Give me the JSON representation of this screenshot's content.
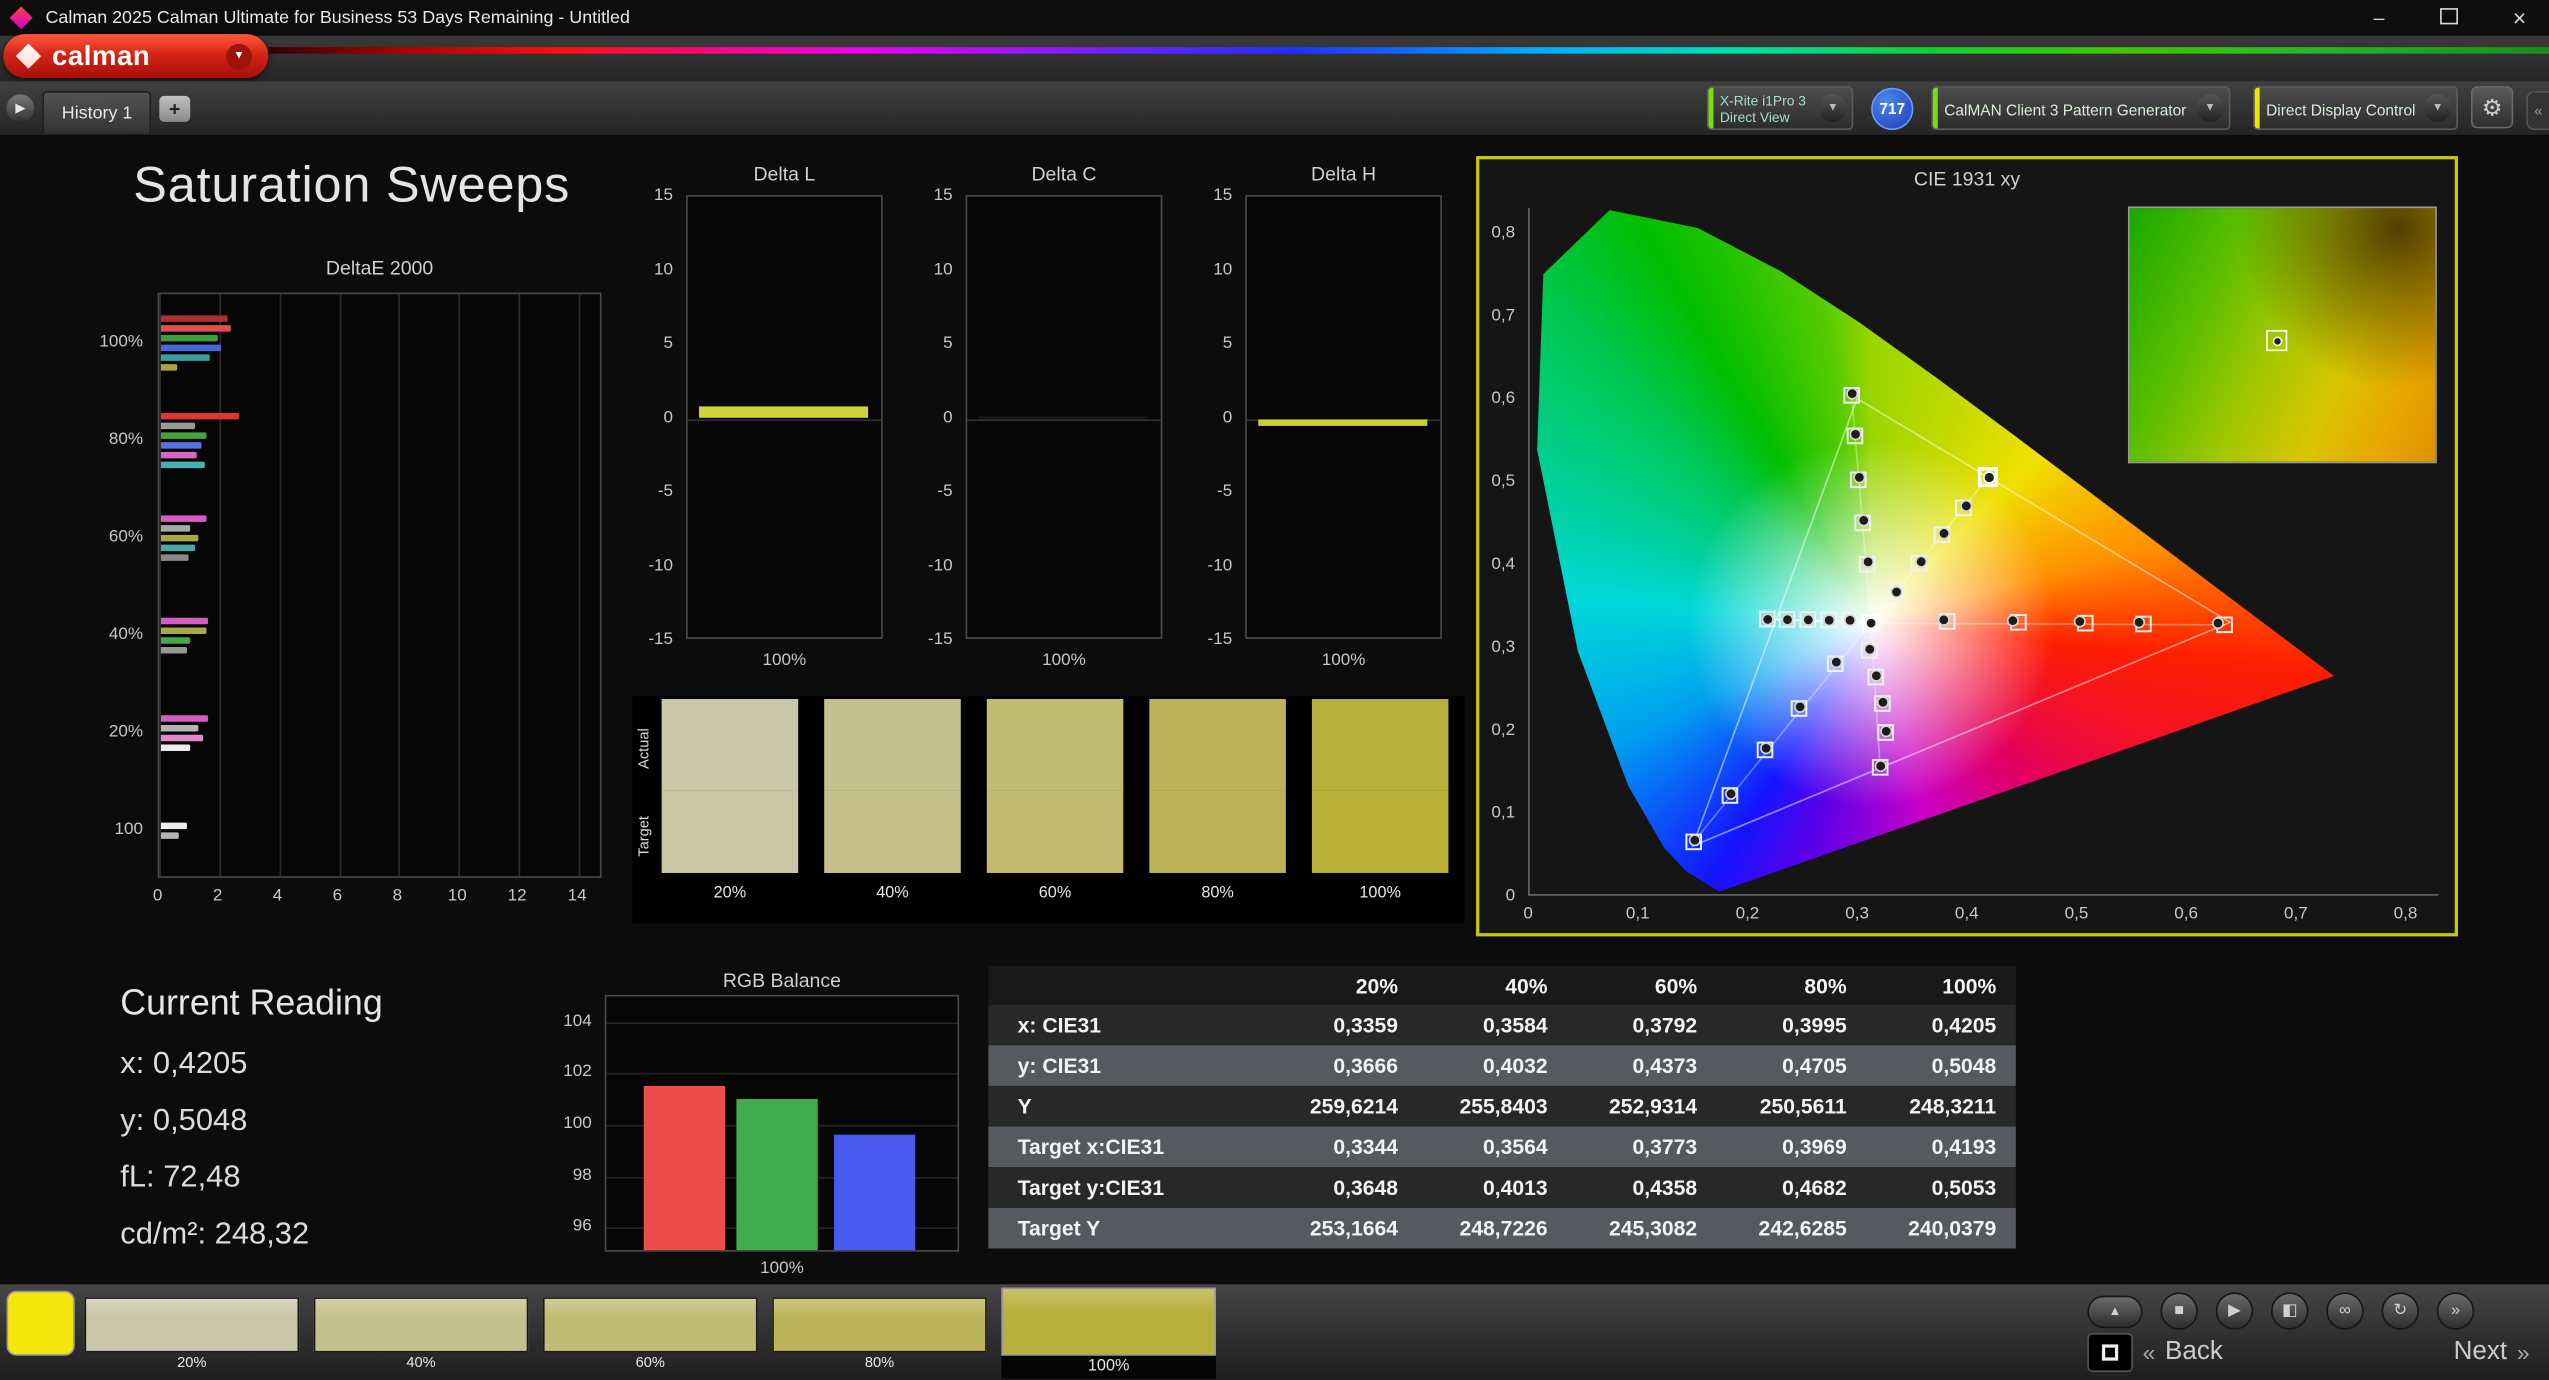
{
  "titlebar": {
    "title": "Calman 2025 Calman Ultimate for Business 53 Days Remaining   - Untitled",
    "minimize": "–",
    "close": "×"
  },
  "header": {
    "logo_text": "calman",
    "meter": {
      "line1": "X-Rite i1Pro 3",
      "line2": "Direct View",
      "accent": "#7ddf00"
    },
    "badge": "717",
    "source_label": "CalMAN Client 3 Pattern Generator",
    "source_accent": "#7ddf00",
    "display_label": "Direct Display Control",
    "display_accent": "#e8e800",
    "gear_glyph": "⚙",
    "chevron_glyph": "▼",
    "handle_glyph": "«"
  },
  "tabbar": {
    "tab_label": "History 1",
    "add_label": "+",
    "arrow_glyph": "▶"
  },
  "page_title": "Saturation Sweeps",
  "current_reading": {
    "title": "Current Reading",
    "lines": [
      "x: 0,4205",
      "y: 0,5048",
      "fL: 72,48",
      "cd/m²: 248,32"
    ]
  },
  "swatch_strip": {
    "row_labels": [
      "Actual",
      "Target"
    ],
    "labels": [
      "20%",
      "40%",
      "60%",
      "80%",
      "100%"
    ],
    "actual": [
      "#c8c7a8",
      "#c5c18e",
      "#c1bc74",
      "#bcb45b",
      "#b8af3d"
    ],
    "target": [
      "#c9c7a3",
      "#c6c18a",
      "#c2bc70",
      "#bdb457",
      "#b9af39"
    ]
  },
  "table": {
    "columns": [
      "20%",
      "40%",
      "60%",
      "80%",
      "100%"
    ],
    "rows": [
      {
        "label": "x: CIE31",
        "values": [
          "0,3359",
          "0,3584",
          "0,3792",
          "0,3995",
          "0,4205"
        ]
      },
      {
        "label": "y: CIE31",
        "values": [
          "0,3666",
          "0,4032",
          "0,4373",
          "0,4705",
          "0,5048"
        ]
      },
      {
        "label": "Y",
        "values": [
          "259,6214",
          "255,8403",
          "252,9314",
          "250,5611",
          "248,3211"
        ]
      },
      {
        "label": "Target x:CIE31",
        "values": [
          "0,3344",
          "0,3564",
          "0,3773",
          "0,3969",
          "0,4193"
        ]
      },
      {
        "label": "Target y:CIE31",
        "values": [
          "0,3648",
          "0,4013",
          "0,4358",
          "0,4682",
          "0,5053"
        ]
      },
      {
        "label": "Target Y",
        "values": [
          "253,1664",
          "248,7226",
          "245,3082",
          "242,6285",
          "240,0379"
        ]
      }
    ]
  },
  "footer": {
    "current_color": "#f2e60c",
    "swatches": [
      {
        "label": "20%",
        "color": "#c8c7a8",
        "active": false
      },
      {
        "label": "40%",
        "color": "#c5c18e",
        "active": false
      },
      {
        "label": "60%",
        "color": "#c1bc74",
        "active": false
      },
      {
        "label": "80%",
        "color": "#bcb45b",
        "active": false
      },
      {
        "label": "100%",
        "color": "#b8af3d",
        "active": true
      }
    ],
    "transport": [
      {
        "name": "eject-button",
        "glyph": "▲"
      },
      {
        "name": "stop-button",
        "glyph": "■"
      },
      {
        "name": "play-button",
        "glyph": "▶"
      },
      {
        "name": "save-button",
        "glyph": "◧"
      },
      {
        "name": "link-button",
        "glyph": "∞"
      },
      {
        "name": "refresh-button",
        "glyph": "↻"
      },
      {
        "name": "more-button",
        "glyph": "»"
      }
    ],
    "nav": {
      "back_glyph": "«",
      "back": "Back",
      "next": "Next",
      "next_glyph": "»"
    }
  },
  "chart_data": [
    {
      "type": "bar",
      "orientation": "horizontal",
      "title": "DeltaE 2000",
      "xticks": [
        0,
        2,
        4,
        6,
        8,
        10,
        12,
        14
      ],
      "xlim": [
        0,
        14.8
      ],
      "groups": [
        {
          "label": "100%",
          "bars": [
            {
              "color": "#a83232",
              "value": 2.2
            },
            {
              "color": "#e05050",
              "value": 2.35
            },
            {
              "color": "#3c9e3c",
              "value": 1.9
            },
            {
              "color": "#4a66dc",
              "value": 2.0
            },
            {
              "color": "#3aa0a0",
              "value": 1.65
            },
            {
              "color": "#a8a83a",
              "value": 0.55
            }
          ]
        },
        {
          "label": "80%",
          "bars": [
            {
              "color": "#e03434",
              "value": 2.6
            },
            {
              "color": "#9a9a9a",
              "value": 1.15
            },
            {
              "color": "#44a444",
              "value": 1.5
            },
            {
              "color": "#5672e0",
              "value": 1.35
            },
            {
              "color": "#d468c4",
              "value": 1.2
            },
            {
              "color": "#44b2b2",
              "value": 1.45
            }
          ]
        },
        {
          "label": "60%",
          "bars": [
            {
              "color": "#d45cc4",
              "value": 1.5
            },
            {
              "color": "#a8a8a8",
              "value": 1.0
            },
            {
              "color": "#a8a846",
              "value": 1.25
            },
            {
              "color": "#46a8a8",
              "value": 1.15
            },
            {
              "color": "#8a8a8a",
              "value": 0.9
            }
          ]
        },
        {
          "label": "40%",
          "bars": [
            {
              "color": "#d45cc4",
              "value": 1.6
            },
            {
              "color": "#a8a846",
              "value": 1.5
            },
            {
              "color": "#46a846",
              "value": 1.0
            },
            {
              "color": "#969696",
              "value": 0.85
            }
          ]
        },
        {
          "label": "20%",
          "bars": [
            {
              "color": "#d45cc4",
              "value": 1.6
            },
            {
              "color": "#b4b4b4",
              "value": 1.25
            },
            {
              "color": "#e088c8",
              "value": 1.4
            },
            {
              "color": "#ececec",
              "value": 1.0
            }
          ]
        },
        {
          "label": "100",
          "bars": [
            {
              "color": "#ececec",
              "value": 0.85
            },
            {
              "color": "#b4b4b4",
              "value": 0.6
            }
          ]
        }
      ]
    },
    {
      "type": "bar",
      "title": "Delta L",
      "ylim": [
        -15,
        15
      ],
      "yticks": [
        15,
        10,
        5,
        0,
        -5,
        -10,
        -15
      ],
      "xlabel": "100%",
      "values": [
        0.8
      ],
      "bar_color": "#ced33d"
    },
    {
      "type": "bar",
      "title": "Delta C",
      "ylim": [
        -15,
        15
      ],
      "yticks": [
        15,
        10,
        5,
        0,
        -5,
        -10,
        -15
      ],
      "xlabel": "100%",
      "values": [
        0.05
      ],
      "bar_color": "#181818"
    },
    {
      "type": "bar",
      "title": "Delta H",
      "ylim": [
        -15,
        15
      ],
      "yticks": [
        15,
        10,
        5,
        0,
        -5,
        -10,
        -15
      ],
      "xlabel": "100%",
      "values": [
        -0.45
      ],
      "bar_color": "#c9ce39"
    },
    {
      "type": "scatter",
      "title": "CIE 1931 xy",
      "xlim": [
        0,
        0.83
      ],
      "ylim": [
        0,
        0.83
      ],
      "xtick_labels": [
        "0",
        "0,1",
        "0,2",
        "0,3",
        "0,4",
        "0,5",
        "0,6",
        "0,7",
        "0,8"
      ],
      "xtick_values": [
        0,
        0.1,
        0.2,
        0.3,
        0.4,
        0.5,
        0.6,
        0.7,
        0.8
      ],
      "ytick_labels": [
        "0,8",
        "0,7",
        "0,6",
        "0,5",
        "0,4",
        "0,3",
        "0,2",
        "0,1",
        "0"
      ],
      "ytick_values": [
        0.8,
        0.7,
        0.6,
        0.5,
        0.4,
        0.3,
        0.2,
        0.1,
        0
      ],
      "white_point": [
        0.3127,
        0.329
      ],
      "gamut_triangle": [
        [
          0.64,
          0.33
        ],
        [
          0.3,
          0.6
        ],
        [
          0.15,
          0.06
        ]
      ],
      "sweeps": [
        {
          "name": "red",
          "targets": [
            [
              0.382,
              0.331
            ],
            [
              0.447,
              0.33
            ],
            [
              0.508,
              0.329
            ],
            [
              0.561,
              0.328
            ],
            [
              0.635,
              0.327
            ]
          ],
          "measured": [
            [
              0.379,
              0.333
            ],
            [
              0.442,
              0.332
            ],
            [
              0.503,
              0.331
            ],
            [
              0.557,
              0.33
            ],
            [
              0.629,
              0.329
            ]
          ]
        },
        {
          "name": "yellow",
          "targets": [
            [
              0.3344,
              0.3648
            ],
            [
              0.3564,
              0.4013
            ],
            [
              0.3773,
              0.4358
            ],
            [
              0.3969,
              0.4682
            ],
            [
              0.4193,
              0.5053
            ]
          ],
          "measured": [
            [
              0.3359,
              0.3666
            ],
            [
              0.3584,
              0.4032
            ],
            [
              0.3792,
              0.4373
            ],
            [
              0.3995,
              0.4705
            ],
            [
              0.4205,
              0.5048
            ]
          ]
        },
        {
          "name": "green",
          "targets": [
            [
              0.309,
              0.4
            ],
            [
              0.305,
              0.45
            ],
            [
              0.301,
              0.502
            ],
            [
              0.298,
              0.555
            ],
            [
              0.295,
              0.604
            ]
          ],
          "measured": [
            [
              0.31,
              0.403
            ],
            [
              0.306,
              0.453
            ],
            [
              0.302,
              0.505
            ],
            [
              0.2985,
              0.557
            ],
            [
              0.2955,
              0.606
            ]
          ]
        },
        {
          "name": "cyan",
          "targets": [
            [
              0.293,
              0.333
            ],
            [
              0.274,
              0.333
            ],
            [
              0.255,
              0.3335
            ],
            [
              0.236,
              0.3335
            ],
            [
              0.218,
              0.334
            ]
          ],
          "measured": [
            [
              0.2935,
              0.3325
            ],
            [
              0.2745,
              0.3325
            ],
            [
              0.2555,
              0.333
            ],
            [
              0.2365,
              0.3332
            ],
            [
              0.2185,
              0.3335
            ]
          ]
        },
        {
          "name": "blue",
          "targets": [
            [
              0.28,
              0.28
            ],
            [
              0.247,
              0.226
            ],
            [
              0.216,
              0.176
            ],
            [
              0.184,
              0.121
            ],
            [
              0.151,
              0.065
            ]
          ],
          "measured": [
            [
              0.281,
              0.282
            ],
            [
              0.248,
              0.228
            ],
            [
              0.217,
              0.178
            ],
            [
              0.185,
              0.123
            ],
            [
              0.152,
              0.067
            ]
          ]
        },
        {
          "name": "magenta",
          "targets": [
            [
              0.311,
              0.296
            ],
            [
              0.317,
              0.264
            ],
            [
              0.323,
              0.232
            ],
            [
              0.326,
              0.197
            ],
            [
              0.321,
              0.155
            ]
          ],
          "measured": [
            [
              0.3115,
              0.2975
            ],
            [
              0.3175,
              0.2655
            ],
            [
              0.3235,
              0.2335
            ],
            [
              0.3265,
              0.1985
            ],
            [
              0.3215,
              0.1565
            ]
          ]
        }
      ],
      "current": {
        "target": [
          0.4193,
          0.5053
        ],
        "measured": [
          0.4205,
          0.5048
        ]
      },
      "inset_marker": [
        0.48,
        0.52
      ]
    },
    {
      "type": "bar",
      "title": "RGB Balance",
      "ylim": [
        95,
        105
      ],
      "yticks": [
        104,
        102,
        100,
        98,
        96
      ],
      "xlabel": "100%",
      "series": [
        {
          "name": "red",
          "value": 101.4,
          "color": "#ef4d4d"
        },
        {
          "name": "green",
          "value": 100.9,
          "color": "#41ab50"
        },
        {
          "name": "blue",
          "value": 99.5,
          "color": "#4a5af0"
        }
      ]
    }
  ]
}
